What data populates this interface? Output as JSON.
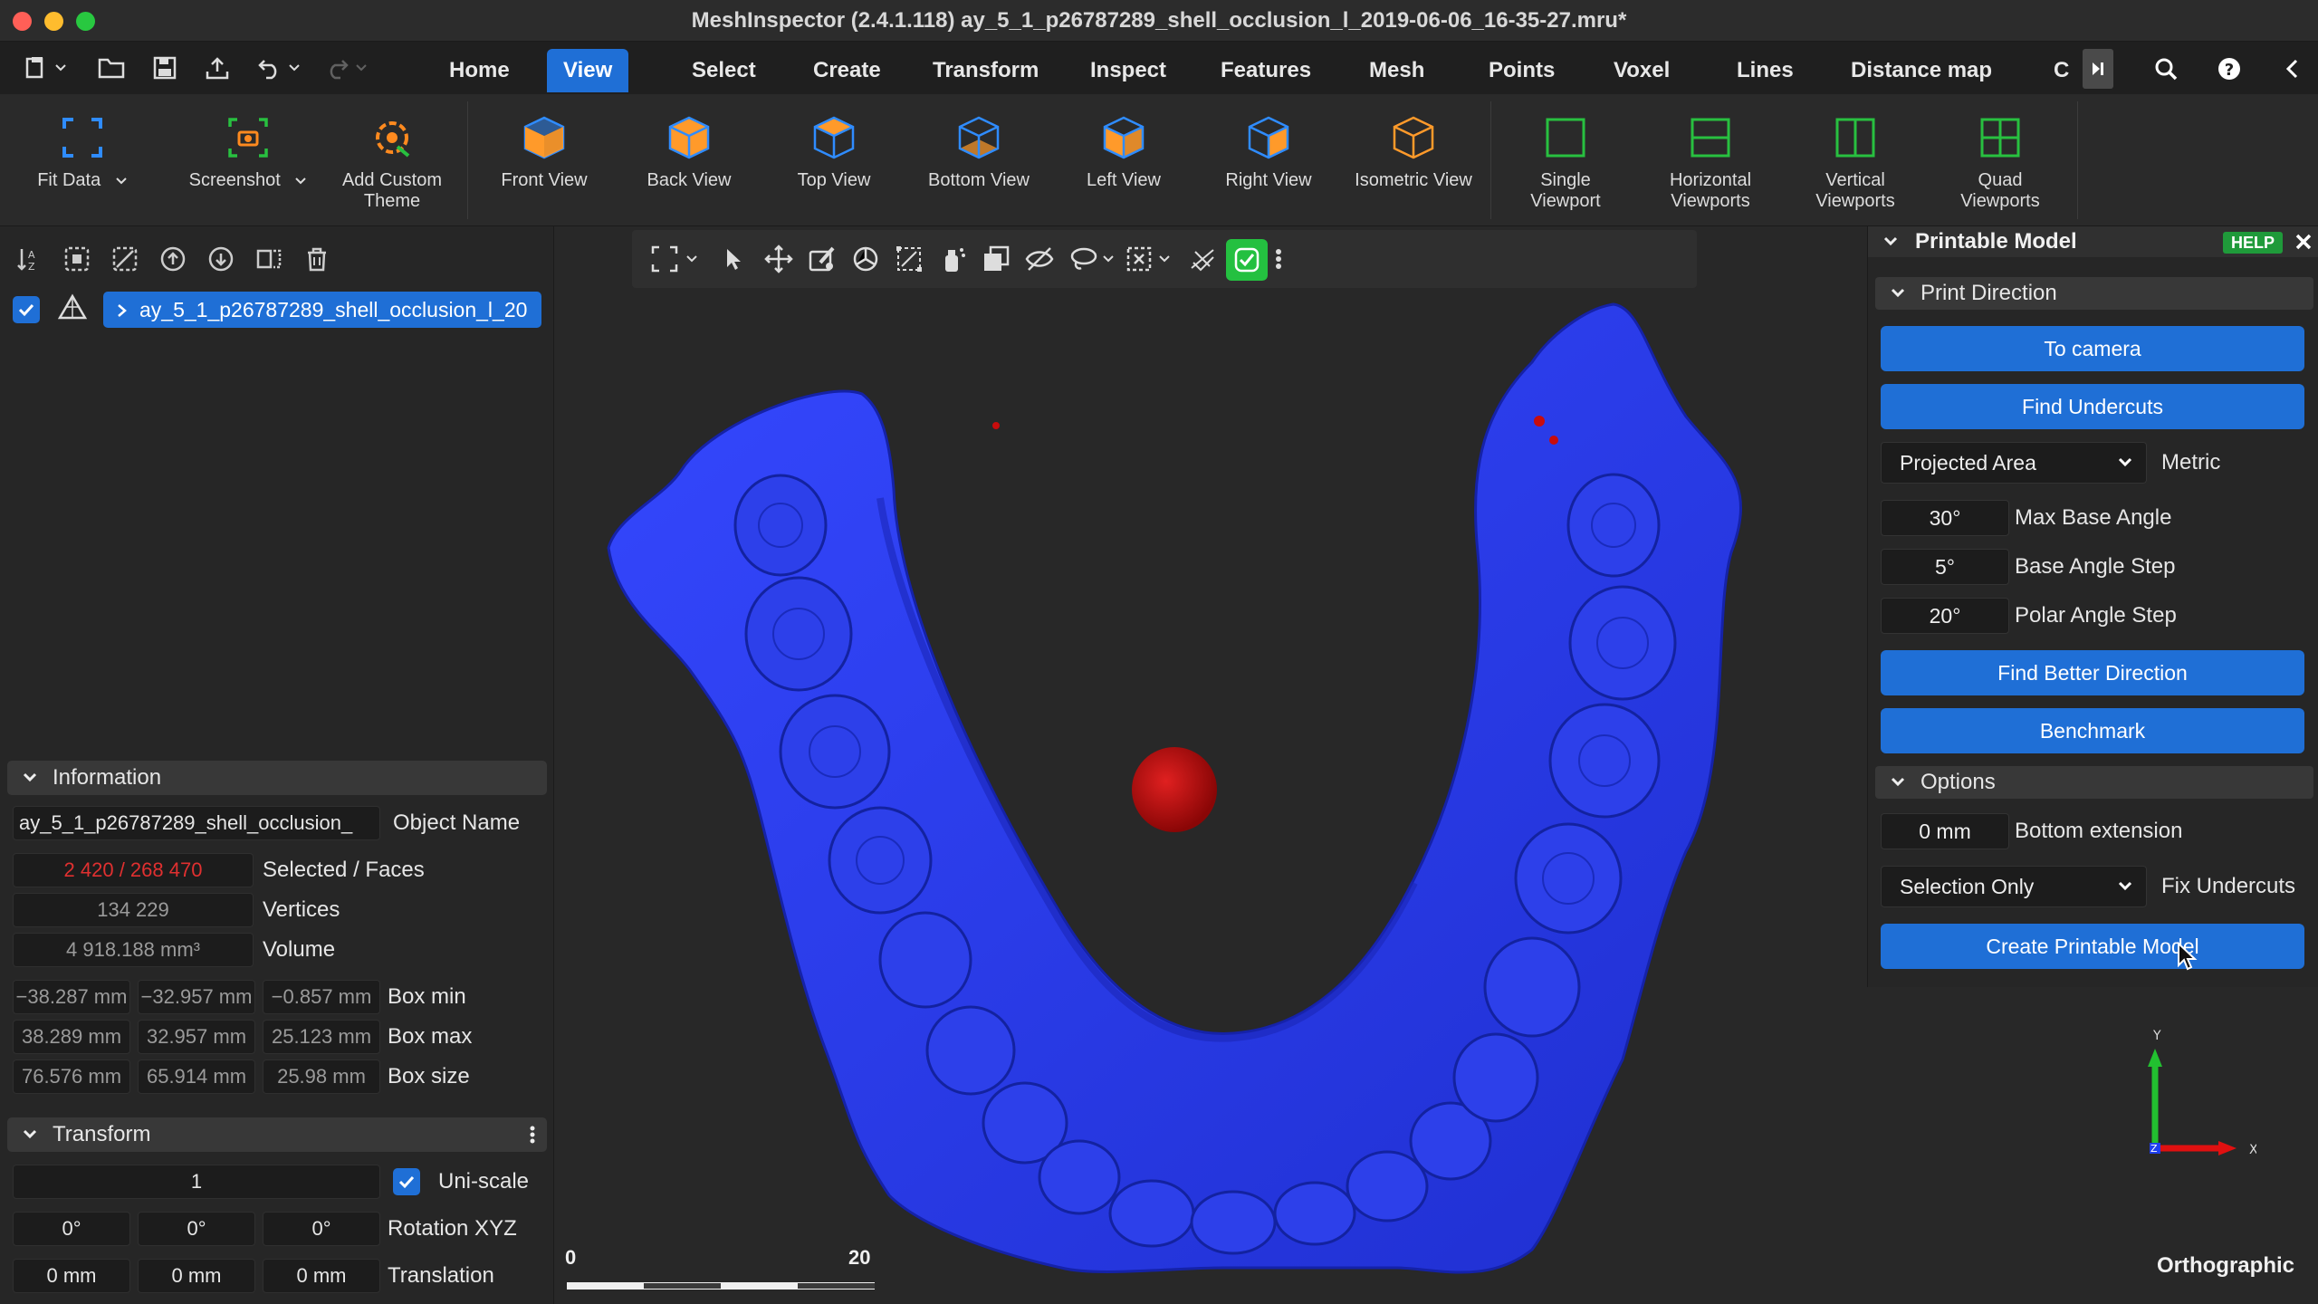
{
  "window": {
    "title": "MeshInspector (2.4.1.118) ay_5_1_p26787289_shell_occlusion_l_2019-06-06_16-35-27.mru*"
  },
  "menu": {
    "tabs": [
      "Home",
      "View",
      "Select",
      "Create",
      "Transform",
      "Inspect",
      "Features",
      "Mesh",
      "Points",
      "Voxel",
      "Lines",
      "Distance map",
      "C"
    ],
    "active": "View"
  },
  "ribbon": {
    "fit_data": "Fit Data",
    "screenshot": "Screenshot",
    "add_custom_theme_1": "Add Custom",
    "add_custom_theme_2": "Theme",
    "front_view": "Front View",
    "back_view": "Back View",
    "top_view": "Top View",
    "bottom_view": "Bottom View",
    "left_view": "Left View",
    "right_view": "Right View",
    "isometric_view": "Isometric View",
    "single_viewport_1": "Single",
    "single_viewport_2": "Viewport",
    "horizontal_viewports_1": "Horizontal",
    "horizontal_viewports_2": "Viewports",
    "vertical_viewports_1": "Vertical",
    "vertical_viewports_2": "Viewports",
    "quad_viewports_1": "Quad",
    "quad_viewports_2": "Viewports"
  },
  "scene_tree": {
    "item": "ay_5_1_p26787289_shell_occlusion_l_20"
  },
  "information": {
    "header": "Information",
    "object_name_value": "ay_5_1_p26787289_shell_occlusion_",
    "object_name_label": "Object Name",
    "selected_faces_value": "2 420 / 268 470",
    "selected_faces_label": "Selected / Faces",
    "vertices_value": "134 229",
    "vertices_label": "Vertices",
    "volume_value": "4 918.188 mm³",
    "volume_label": "Volume",
    "box_min": [
      "−38.287 mm",
      "−32.957 mm",
      "−0.857 mm"
    ],
    "box_min_label": "Box min",
    "box_max": [
      "38.289 mm",
      "32.957 mm",
      "25.123 mm"
    ],
    "box_max_label": "Box max",
    "box_size": [
      "76.576 mm",
      "65.914 mm",
      "25.98 mm"
    ],
    "box_size_label": "Box size"
  },
  "transform": {
    "header": "Transform",
    "scale_value": "1",
    "uniscale_label": "Uni-scale",
    "rotation": [
      "0°",
      "0°",
      "0°"
    ],
    "rotation_label": "Rotation XYZ",
    "translation": [
      "0 mm",
      "0 mm",
      "0 mm"
    ],
    "translation_label": "Translation"
  },
  "viewport": {
    "projection": "Orthographic",
    "scale_start": "0",
    "scale_end": "20",
    "axis_x": "X",
    "axis_y": "Y",
    "axis_z": "Z",
    "mesh_color": "#2a3cf0",
    "marker_color": "#c80c0c"
  },
  "printable_model": {
    "title": "Printable Model",
    "help": "HELP",
    "print_direction_header": "Print Direction",
    "to_camera": "To camera",
    "find_undercuts": "Find Undercuts",
    "metric_value": "Projected Area",
    "metric_label": "Metric",
    "max_base_angle_value": "30°",
    "max_base_angle_label": "Max Base Angle",
    "base_angle_step_value": "5°",
    "base_angle_step_label": "Base Angle Step",
    "polar_angle_step_value": "20°",
    "polar_angle_step_label": "Polar Angle Step",
    "find_better_direction": "Find Better Direction",
    "benchmark": "Benchmark",
    "options_header": "Options",
    "bottom_extension_value": "0 mm",
    "bottom_extension_label": "Bottom extension",
    "fix_undercuts_value": "Selection Only",
    "fix_undercuts_label": "Fix Undercuts",
    "create_printable_model": "Create Printable Model"
  }
}
